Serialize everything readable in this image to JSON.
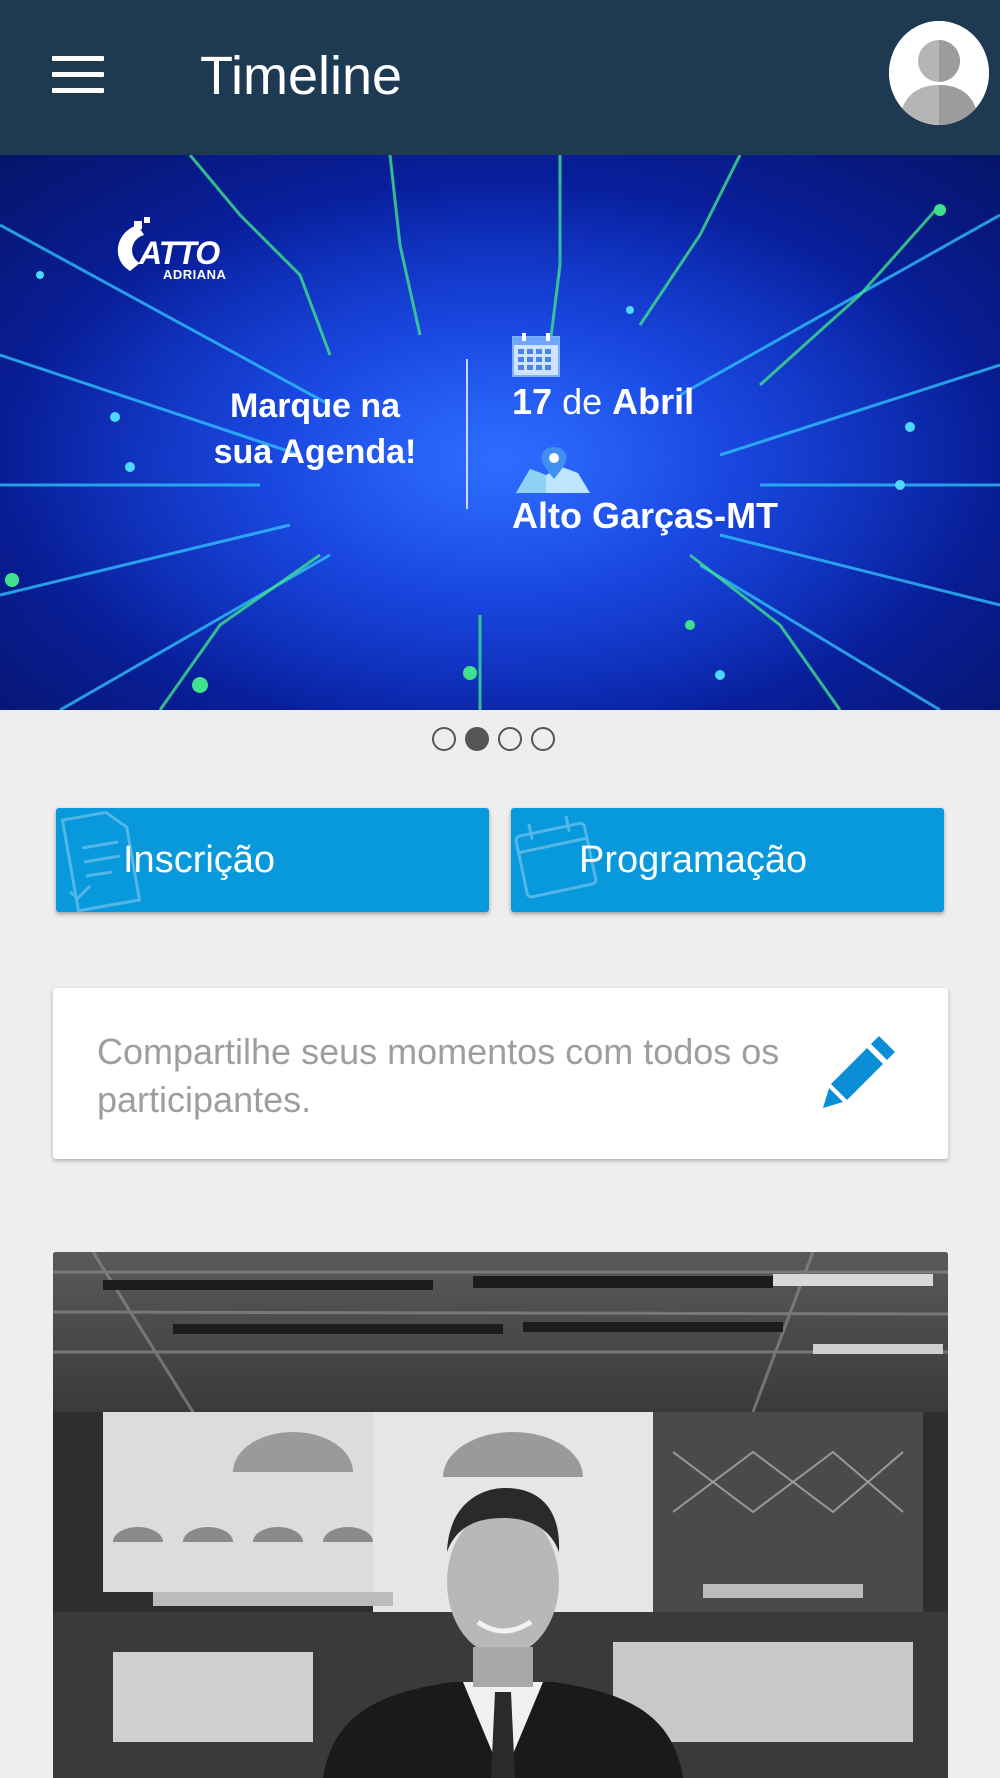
{
  "app_bar": {
    "title": "Timeline",
    "menu_icon": "hamburger-menu-icon",
    "avatar_icon": "user-avatar-icon"
  },
  "banner": {
    "logo_text": "ATTO",
    "logo_sub": "ADRIANA",
    "headline_line1": "Marque na",
    "headline_line2": "sua Agenda!",
    "date_day": "17",
    "date_de": "de",
    "date_month": "Abril",
    "place": "Alto Garças-MT",
    "calendar_icon": "calendar-icon",
    "map_icon": "map-pin-icon"
  },
  "carousel": {
    "count": 4,
    "active_index": 1
  },
  "actions": {
    "inscricao_label": "Inscrição",
    "programacao_label": "Programação"
  },
  "share": {
    "prompt": "Compartilhe seus momentos com todos os participantes.",
    "icon": "pencil-icon"
  },
  "colors": {
    "app_bar": "#1e3a52",
    "accent": "#0898dc",
    "background": "#eeeeee"
  }
}
